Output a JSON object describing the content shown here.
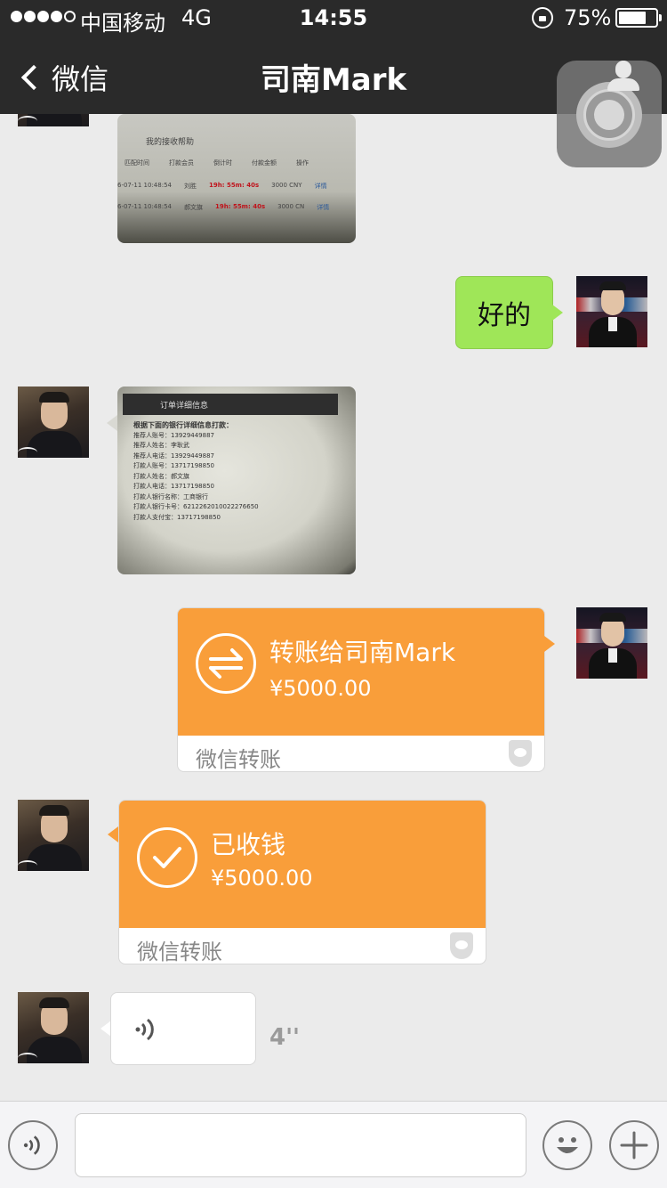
{
  "status_bar": {
    "carrier": "中国移动",
    "network": "4G",
    "time": "14:55",
    "battery_percent": "75%",
    "battery_level": 0.75,
    "signal_dots_filled": 4,
    "signal_dots_total": 5
  },
  "nav": {
    "back_label": "微信",
    "title": "司南Mark"
  },
  "messages": {
    "photo1": {
      "heading": "我的接收帮助",
      "columns": [
        "匹配时间",
        "打款会员",
        "倒计时",
        "付款金额",
        "操作"
      ],
      "rows": [
        {
          "time": "6-07-11 10:48:54",
          "member": "刘胜",
          "countdown": "19h: 55m: 40s",
          "amount": "3000 CNY",
          "action": "详情"
        },
        {
          "time": "6-07-11 10:48:54",
          "member": "郝文旗",
          "countdown": "19h: 55m: 40s",
          "amount": "3000 CN",
          "action": "详情"
        }
      ]
    },
    "reply_text": "好的",
    "photo2": {
      "bar_title": "订单详细信息",
      "lines": [
        "根据下面的银行详细信息打款：",
        "推荐人账号：13929449887",
        "推荐人姓名：李耿武",
        "推荐人电话：13929449887",
        "打款人账号：13717198850",
        "打款人姓名：郝文旗",
        "打款人电话：13717198850",
        "打款人银行名称：工商银行",
        "打款人银行卡号：6212262010022276650",
        "打款人支付宝：13717198850"
      ]
    },
    "transfer_sent": {
      "title": "转账给司南Mark",
      "amount": "¥5000.00",
      "footer": "微信转账"
    },
    "transfer_received": {
      "title": "已收钱",
      "amount": "¥5000.00",
      "footer": "微信转账"
    },
    "voice": {
      "duration": "4''"
    }
  },
  "colors": {
    "nav_bg": "#2a2a2a",
    "chat_bg": "#ebebeb",
    "my_bubble": "#9fe658",
    "transfer_orange": "#f99e3a"
  },
  "icons": {
    "back": "chevron-left-icon",
    "assistive_touch": "assistive-touch-icon",
    "profile": "person-icon",
    "transfer": "exchange-arrows-icon",
    "received": "check-icon",
    "wechat_pay": "shield-icon",
    "voice": "sound-wave-icon",
    "emoji": "smiley-icon",
    "plus": "plus-icon"
  }
}
